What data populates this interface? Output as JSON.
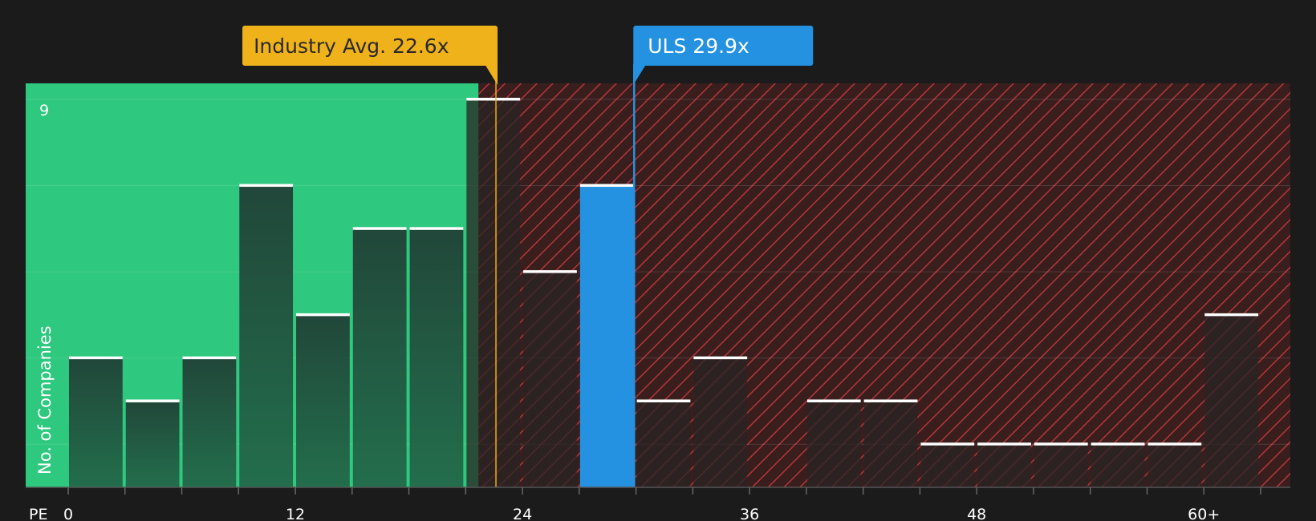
{
  "chart_data": {
    "type": "bar",
    "x_axis_label": "PE",
    "y_axis_label": "No. of Companies",
    "x_ticks": [
      "0",
      "12",
      "24",
      "36",
      "48",
      "60+"
    ],
    "y_ticks": [
      "9"
    ],
    "ylim": [
      0,
      9
    ],
    "bin_width": 3,
    "bins": [
      {
        "x_start": 0,
        "count": 3
      },
      {
        "x_start": 3,
        "count": 2
      },
      {
        "x_start": 6,
        "count": 3
      },
      {
        "x_start": 9,
        "count": 7
      },
      {
        "x_start": 12,
        "count": 4
      },
      {
        "x_start": 15,
        "count": 6
      },
      {
        "x_start": 18,
        "count": 6
      },
      {
        "x_start": 21,
        "count": 9
      },
      {
        "x_start": 24,
        "count": 5
      },
      {
        "x_start": 27,
        "count": 7
      },
      {
        "x_start": 30,
        "count": 2
      },
      {
        "x_start": 33,
        "count": 3
      },
      {
        "x_start": 36,
        "count": 0
      },
      {
        "x_start": 39,
        "count": 2
      },
      {
        "x_start": 42,
        "count": 2
      },
      {
        "x_start": 45,
        "count": 1
      },
      {
        "x_start": 48,
        "count": 1
      },
      {
        "x_start": 51,
        "count": 1
      },
      {
        "x_start": 54,
        "count": 1
      },
      {
        "x_start": 57,
        "count": 1
      },
      {
        "x_start": 60,
        "count": 4
      }
    ],
    "highlight_bin_x_start": 27,
    "industry_avg": {
      "value": 22.6,
      "label": "Industry Avg. 22.6x"
    },
    "company": {
      "value": 29.9,
      "label": "ULS 29.9x"
    },
    "colors": {
      "background": "#1b1b1b",
      "undervalued_zone": "#2ec87e",
      "overvalued_zone": "#3a1e1e",
      "hatch": "#c73b3b",
      "bar_green": "#1f4a36",
      "bar_dark": "#2a2424",
      "bar_highlight": "#2492e0",
      "industry_avg": "#f0b21b",
      "company": "#2492e0",
      "cap": "#ffffff"
    }
  }
}
